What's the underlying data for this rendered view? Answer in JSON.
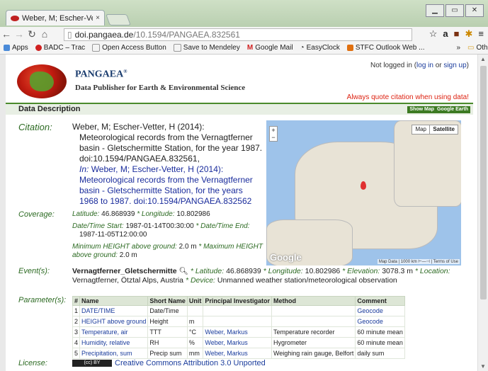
{
  "browser": {
    "tab_title": "Weber, M; Escher-Vetter, I",
    "tab_close": "×",
    "url_domain": "doi.pangaea.de",
    "url_path": "/10.1594/PANGAEA.832561",
    "bookmarks": [
      "Apps",
      "BADC – Trac",
      "Open Access Button",
      "Save to Mendeley",
      "Google Mail",
      "EasyClock",
      "STFC Outlook Web ..."
    ],
    "bookmarks_more": "»",
    "other_bookmarks": "Other bookmarks"
  },
  "header": {
    "brand": "PANGAEA",
    "brand_mark": "®",
    "subtitle": "Data Publisher for Earth & Environmental Science",
    "login_prefix": "Not logged in (",
    "login_link": "log in",
    "login_mid": " or ",
    "signup_link": "sign up",
    "login_suffix": ")",
    "quote_notice": "Always quote citation when using data!"
  },
  "section": {
    "title": "Data Description",
    "show_map": "Show Map",
    "google_earth": "Google Earth"
  },
  "citation": {
    "label": "Citation:",
    "line1": "Weber, M; Escher-Vetter, H (2014):",
    "line2": "Meteorological records from the Vernagtferner basin - Gletschermitte Station, for the year 1987. doi:10.1594/PANGAEA.832561,",
    "in_label": "In:",
    "line3": "Weber, M; Escher-Vetter, H (2014): Meteorological records from the Vernagtferner basin - Gletschermitte Station, for the years 1968 to 1987. doi:10.1594/PANGAEA.832562"
  },
  "map": {
    "btn_map": "Map",
    "btn_satellite": "Satellite",
    "zoom_in": "+",
    "zoom_out": "−",
    "logo": "Google",
    "attribution": "Map Data | 1000 km ⊢—⊣ | Terms of Use"
  },
  "coverage": {
    "label": "Coverage:",
    "lat_label": "Latitude:",
    "lat": "46.868939",
    "lon_label": "* Longitude:",
    "lon": "10.802986",
    "start_label": "Date/Time Start:",
    "start": "1987-01-14T00:30:00",
    "end_label": "* Date/Time End:",
    "end": "1987-11-05T12:00:00",
    "min_h_label": "Minimum HEIGHT above ground:",
    "min_h": "2.0 m",
    "max_h_label": "* Maximum HEIGHT above ground:",
    "max_h": "2.0 m"
  },
  "event": {
    "label": "Event(s):",
    "name": "Vernagtferner_Gletschermitte",
    "lat_label": "* Latitude:",
    "lat": "46.868939",
    "lon_label": "* Longitude:",
    "lon": "10.802986",
    "elev_label": "* Elevation:",
    "elev": "3078.3 m",
    "loc_label": "* Location:",
    "loc": "Vernagtferner, Ötztal Alps, Austria",
    "dev_label": "* Device:",
    "dev": "Unmanned weather station/meteorological observation"
  },
  "parameters": {
    "label": "Parameter(s):",
    "headers": [
      "#",
      "Name",
      "Short Name",
      "Unit",
      "Principal Investigator",
      "Method",
      "Comment"
    ],
    "rows": [
      [
        "1",
        "DATE/TIME",
        "Date/Time",
        "",
        "",
        "",
        "Geocode"
      ],
      [
        "2",
        "HEIGHT above ground",
        "Height",
        "m",
        "",
        "",
        "Geocode"
      ],
      [
        "3",
        "Temperature, air",
        "TTT",
        "°C",
        "Weber, Markus",
        "Temperature recorder",
        "60 minute mean"
      ],
      [
        "4",
        "Humidity, relative",
        "RH",
        "%",
        "Weber, Markus",
        "Hygrometer",
        "60 minute mean"
      ],
      [
        "5",
        "Precipitation, sum",
        "Precip sum",
        "mm",
        "Weber, Markus",
        "Weighing rain gauge, Belfort",
        "daily sum"
      ]
    ]
  },
  "license": {
    "label": "License:",
    "badge": "(cc) BY",
    "text": "Creative Commons Attribution 3.0 Unported"
  }
}
